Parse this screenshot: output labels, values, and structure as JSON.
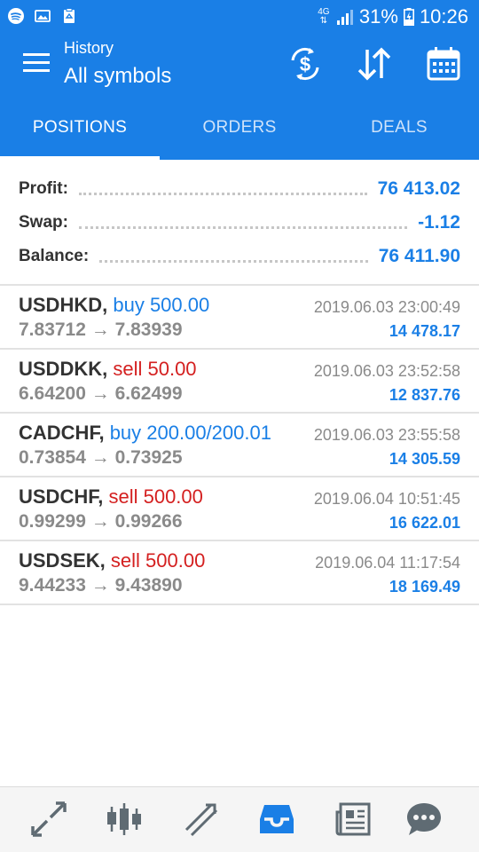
{
  "status_bar": {
    "network": "4G",
    "battery_percent": "31%",
    "time": "10:26"
  },
  "app_bar": {
    "subtitle": "History",
    "title": "All symbols",
    "icons": [
      "menu-icon",
      "currency-exchange-icon",
      "sort-icon",
      "calendar-icon"
    ]
  },
  "tabs": [
    {
      "label": "POSITIONS",
      "active": true
    },
    {
      "label": "ORDERS",
      "active": false
    },
    {
      "label": "DEALS",
      "active": false
    }
  ],
  "summary": {
    "profit_label": "Profit:",
    "profit_value": "76 413.02",
    "swap_label": "Swap:",
    "swap_value": "-1.12",
    "balance_label": "Balance:",
    "balance_value": "76 411.90"
  },
  "deals": [
    {
      "symbol": "USDHKD,",
      "direction": "buy 500.00",
      "type": "buy",
      "open_price": "7.83712",
      "arrow": "→",
      "close_price": "7.83939",
      "time": "2019.06.03 23:00:49",
      "profit": "14 478.17"
    },
    {
      "symbol": "USDDKK,",
      "direction": "sell 50.00",
      "type": "sell",
      "open_price": "6.64200",
      "arrow": "→",
      "close_price": "6.62499",
      "time": "2019.06.03 23:52:58",
      "profit": "12 837.76"
    },
    {
      "symbol": "CADCHF,",
      "direction": "buy 200.00/200.01",
      "type": "buy",
      "open_price": "0.73854",
      "arrow": "→",
      "close_price": "0.73925",
      "time": "2019.06.03 23:55:58",
      "profit": "14 305.59"
    },
    {
      "symbol": "USDCHF,",
      "direction": "sell 500.00",
      "type": "sell",
      "open_price": "0.99299",
      "arrow": "→",
      "close_price": "0.99266",
      "time": "2019.06.04 10:51:45",
      "profit": "16 622.01"
    },
    {
      "symbol": "USDSEK,",
      "direction": "sell 500.00",
      "type": "sell",
      "open_price": "9.44233",
      "arrow": "→",
      "close_price": "9.43890",
      "time": "2019.06.04 11:17:54",
      "profit": "18 169.49"
    }
  ],
  "bottom_nav": [
    {
      "icon": "quotes-icon",
      "active": false
    },
    {
      "icon": "chart-candles-icon",
      "active": false
    },
    {
      "icon": "trade-icon",
      "active": false
    },
    {
      "icon": "history-inbox-icon",
      "active": true
    },
    {
      "icon": "news-icon",
      "active": false
    },
    {
      "icon": "chat-icon",
      "active": false
    }
  ],
  "colors": {
    "accent": "#1a7fe6",
    "sell": "#d42020",
    "muted": "#8a8a8a",
    "nav_inactive": "#5f6b73"
  }
}
